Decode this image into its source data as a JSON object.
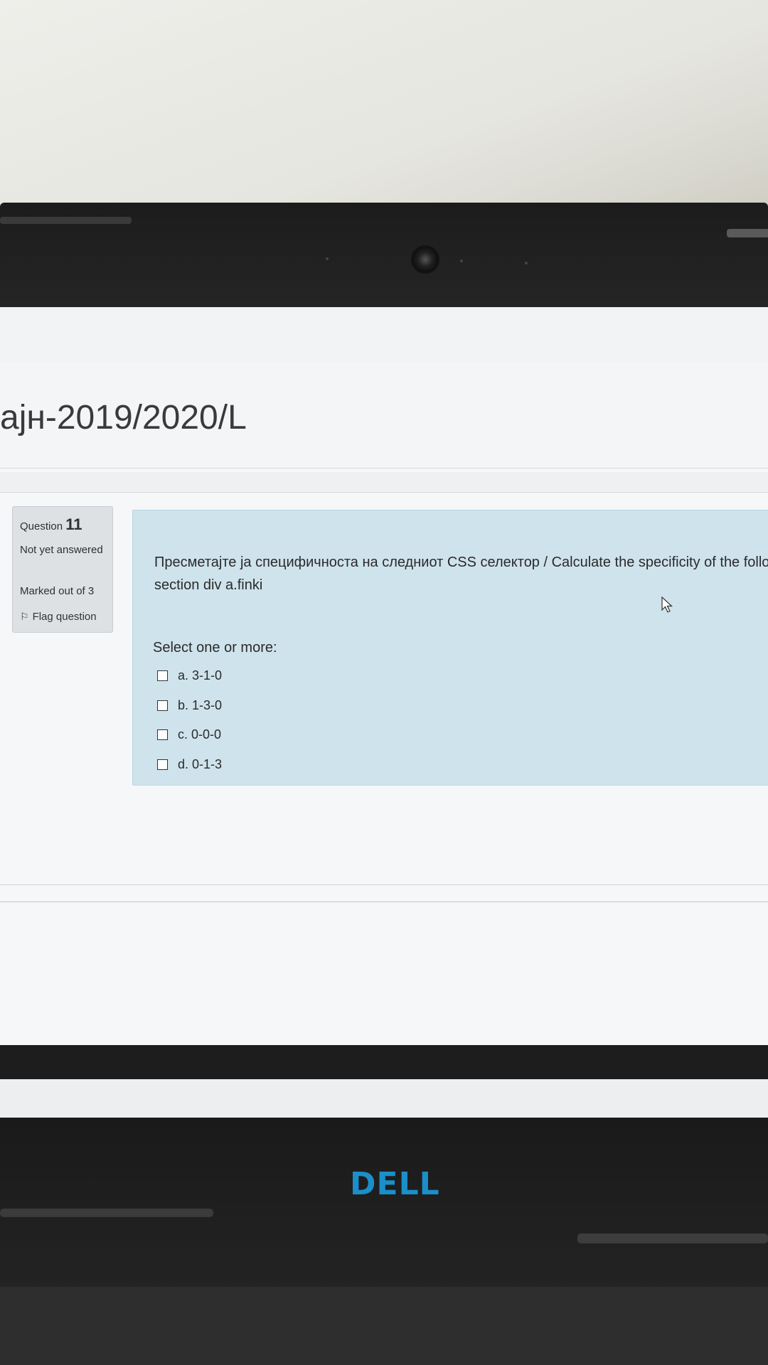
{
  "course": {
    "title": "ајн-2019/2020/L"
  },
  "question_info": {
    "label": "Question",
    "number": "11",
    "state": "Not yet answered",
    "grade": "Marked out of 3",
    "flag_label": "Flag question"
  },
  "question": {
    "text_line1": "Пресметајте ја специфичноста на следниот CSS селектор / Calculate the specificity of the follo",
    "text_line2": "section div a.finki",
    "prompt": "Select one or more:",
    "answers": [
      {
        "label": "a. 3-1-0",
        "checked": false
      },
      {
        "label": "b. 1-3-0",
        "checked": false
      },
      {
        "label": "c. 0-0-0",
        "checked": false
      },
      {
        "label": "d. 0-1-3",
        "checked": false
      }
    ]
  },
  "device": {
    "logo": "DELL"
  },
  "colors": {
    "formulation_bg": "#cfe3ec",
    "info_bg": "#dee1e4",
    "logo": "#1a8fc9"
  },
  "icons": {
    "flag": "flag-icon",
    "cursor": "mouse-pointer-icon",
    "webcam": "webcam-icon"
  }
}
